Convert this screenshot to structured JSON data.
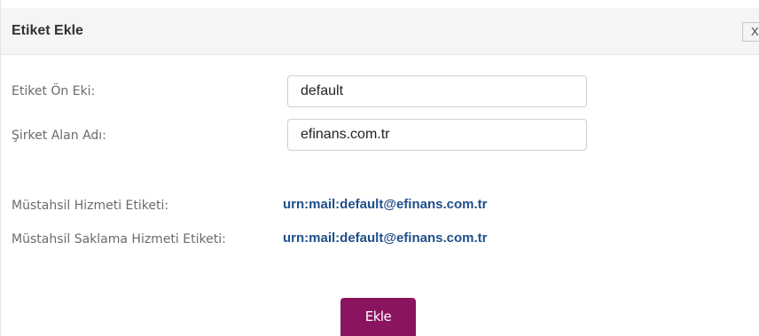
{
  "dialog": {
    "title": "Etiket Ekle",
    "close_label": "X"
  },
  "form": {
    "prefix_label": "Etiket Ön Eki:",
    "prefix_value": "default",
    "domain_label": "Şirket Alan Adı:",
    "domain_value": "efinans.com.tr",
    "service_label": "Müstahsil Hizmeti Etiketi:",
    "service_value": "urn:mail:default@efinans.com.tr",
    "storage_label": "Müstahsil Saklama Hizmeti Etiketi:",
    "storage_value": "urn:mail:default@efinans.com.tr"
  },
  "actions": {
    "add_label": "Ekle"
  },
  "colors": {
    "header_bg": "#f5f5f5",
    "link": "#1f4f8a",
    "primary_button": "#8b1460"
  }
}
